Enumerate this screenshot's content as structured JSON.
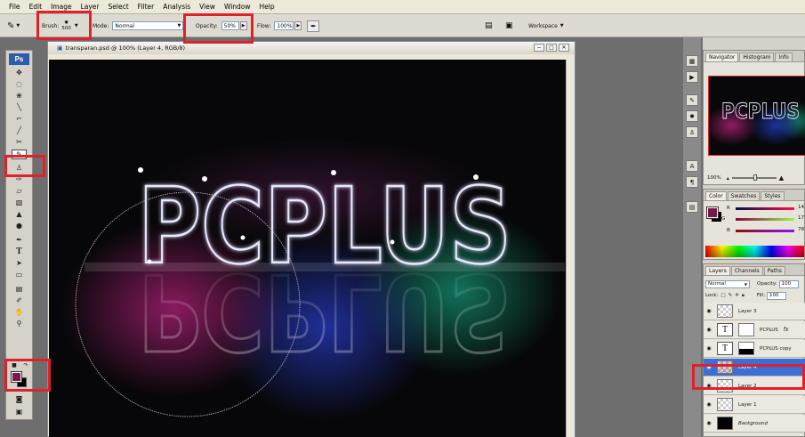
{
  "menu": [
    "File",
    "Edit",
    "Image",
    "Layer",
    "Select",
    "Filter",
    "Analysis",
    "View",
    "Window",
    "Help"
  ],
  "options": {
    "brush_label": "Brush:",
    "brush_size": "500",
    "mode_label": "Mode:",
    "mode_value": "Normal",
    "opacity_label": "Opacity:",
    "opacity_value": "50%",
    "flow_label": "Flow:",
    "flow_value": "100%",
    "workspace_label": "Workspace"
  },
  "toolbox": {
    "logo": "Ps"
  },
  "document": {
    "title": "transparan.psd @ 100% (Layer 4, RGB/8)",
    "artwork_text": "PCPLUS"
  },
  "navigator": {
    "tabs": [
      "Navigator",
      "Histogram",
      "Info"
    ],
    "zoom": "100%",
    "thumb_text": "PCPLUS"
  },
  "color": {
    "tabs": [
      "Color",
      "Swatches",
      "Styles"
    ],
    "r_label": "R",
    "g_label": "G",
    "b_label": "B",
    "r_value": "14",
    "g_value": "17",
    "b_value": "78"
  },
  "layers": {
    "tabs": [
      "Layers",
      "Channels",
      "Paths"
    ],
    "blend": "Normal",
    "opacity_label": "Opacity:",
    "opacity_value": "100",
    "lock_label": "Lock:",
    "fill_label": "Fill:",
    "fill_value": "100",
    "items": [
      {
        "name": "Layer 3"
      },
      {
        "name": "PCPLUS"
      },
      {
        "name": "PCPLUS copy"
      },
      {
        "name": "Layer 4"
      },
      {
        "name": "Layer 2"
      },
      {
        "name": "Layer 1"
      },
      {
        "name": "Background"
      }
    ]
  },
  "colors": {
    "foreground": "#7a1a48",
    "background": "#000000",
    "selection": "#3a6fd6",
    "highlight": "#e0202a"
  }
}
